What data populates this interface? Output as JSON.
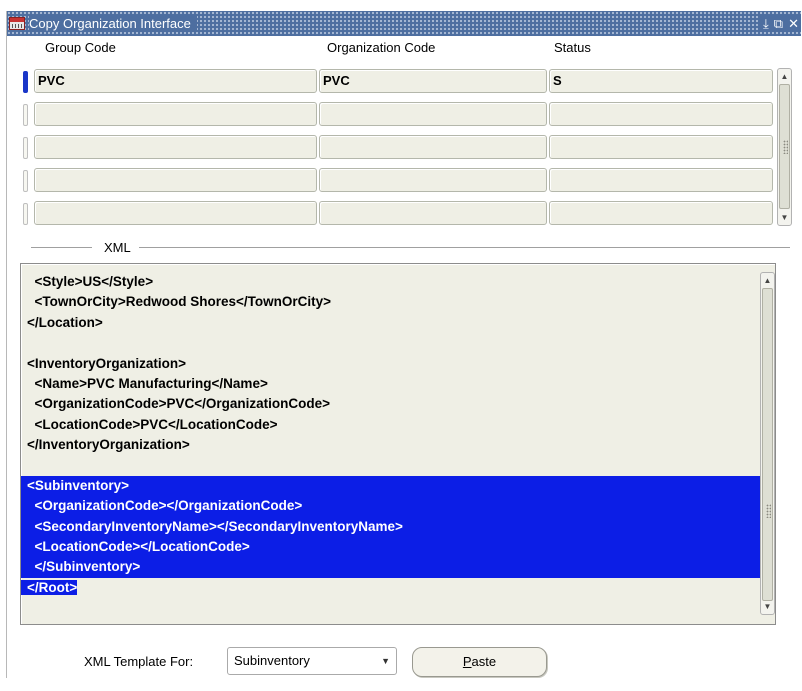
{
  "window": {
    "title": "Copy Organization Interface"
  },
  "title_controls": {
    "minimize": "⤓",
    "restore": "⧉",
    "close": "✕"
  },
  "grid": {
    "headers": [
      "Group Code",
      "Organization Code",
      "Status"
    ],
    "rows": [
      {
        "group_code": "PVC",
        "organization_code": "PVC",
        "status": "S"
      },
      {
        "group_code": "",
        "organization_code": "",
        "status": ""
      },
      {
        "group_code": "",
        "organization_code": "",
        "status": ""
      },
      {
        "group_code": "",
        "organization_code": "",
        "status": ""
      },
      {
        "group_code": "",
        "organization_code": "",
        "status": ""
      }
    ]
  },
  "xml_section": {
    "label": "XML",
    "lines": [
      "  <Style>US</Style>",
      "  <TownOrCity>Redwood Shores</TownOrCity>",
      "</Location>",
      "",
      "<InventoryOrganization>",
      "  <Name>PVC Manufacturing</Name>",
      "  <OrganizationCode>PVC</OrganizationCode>",
      "  <LocationCode>PVC</LocationCode>",
      "</InventoryOrganization>",
      "",
      "<Subinventory>",
      "  <OrganizationCode></OrganizationCode>",
      "  <SecondaryInventoryName></SecondaryInventoryName>",
      "  <LocationCode></LocationCode>",
      "  </Subinventory>",
      "</Root>"
    ],
    "selected_lines_from": 10,
    "partial_selected_line": 15
  },
  "footer": {
    "template_label": "XML Template For:",
    "template_value": "Subinventory",
    "paste_label_mnemonic": "P",
    "paste_label_rest": "aste"
  },
  "colors": {
    "title_bar": "#4d6ea0",
    "selection": "#0c1ee6",
    "field_bg": "#efefe5",
    "current_row_indicator": "#1a36c8"
  },
  "icons": {
    "app": "oracle-app-icon",
    "dropdown": "chevron-down-icon"
  }
}
